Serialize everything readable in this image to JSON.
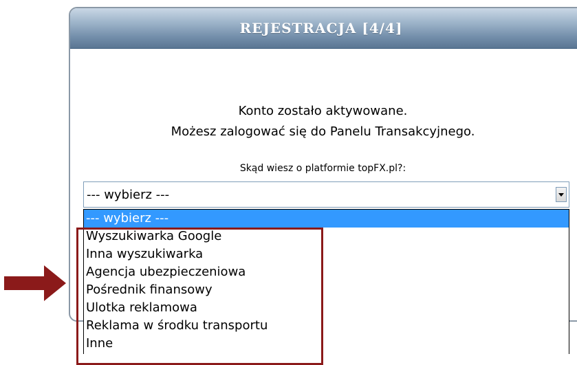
{
  "window": {
    "title": "REJESTRACJA [4/4]"
  },
  "message": {
    "line1": "Konto zostało aktywowane.",
    "line2": "Możesz zalogować się do Panelu Transakcyjnego."
  },
  "form": {
    "question_label": "Skąd wiesz o platformie topFX.pl?:",
    "select_value": "--- wybierz ---",
    "options": [
      "--- wybierz ---",
      "Wyszukiwarka Google",
      "Inna wyszukiwarka",
      "Agencja ubezpieczeniowa",
      "Pośrednik finansowy",
      "Ulotka reklamowa",
      "Reklama w środku transportu",
      "Inne"
    ],
    "selected_index": 0
  },
  "colors": {
    "header_gradient_top": "#c9d7e5",
    "header_gradient_bottom": "#5a7693",
    "selection": "#3399ff",
    "annotation": "#8b1a1a"
  },
  "icons": {
    "dropdown": "chevron-down-icon",
    "annotation_arrow": "arrow-right-icon"
  }
}
